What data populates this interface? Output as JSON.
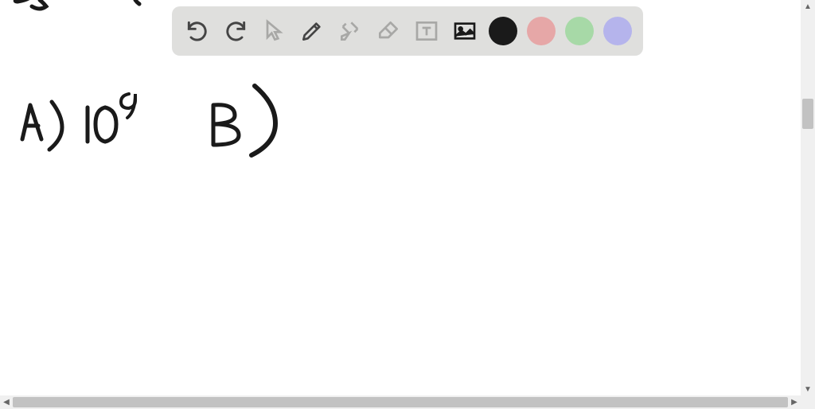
{
  "toolbar": {
    "tools": [
      "undo",
      "redo",
      "pointer",
      "pencil",
      "settings-tools",
      "eraser",
      "text-box",
      "image",
      "color-black",
      "color-pink",
      "color-green",
      "color-purple"
    ]
  },
  "colors": {
    "black": "#1a1a1a",
    "pink": "#e6a7a7",
    "green": "#a7d9a7",
    "purple": "#b5b4ec"
  },
  "handwriting": {
    "answer_a_label": "A)",
    "answer_a_value": "10",
    "answer_a_exponent": "9",
    "answer_b_label": "B)"
  }
}
